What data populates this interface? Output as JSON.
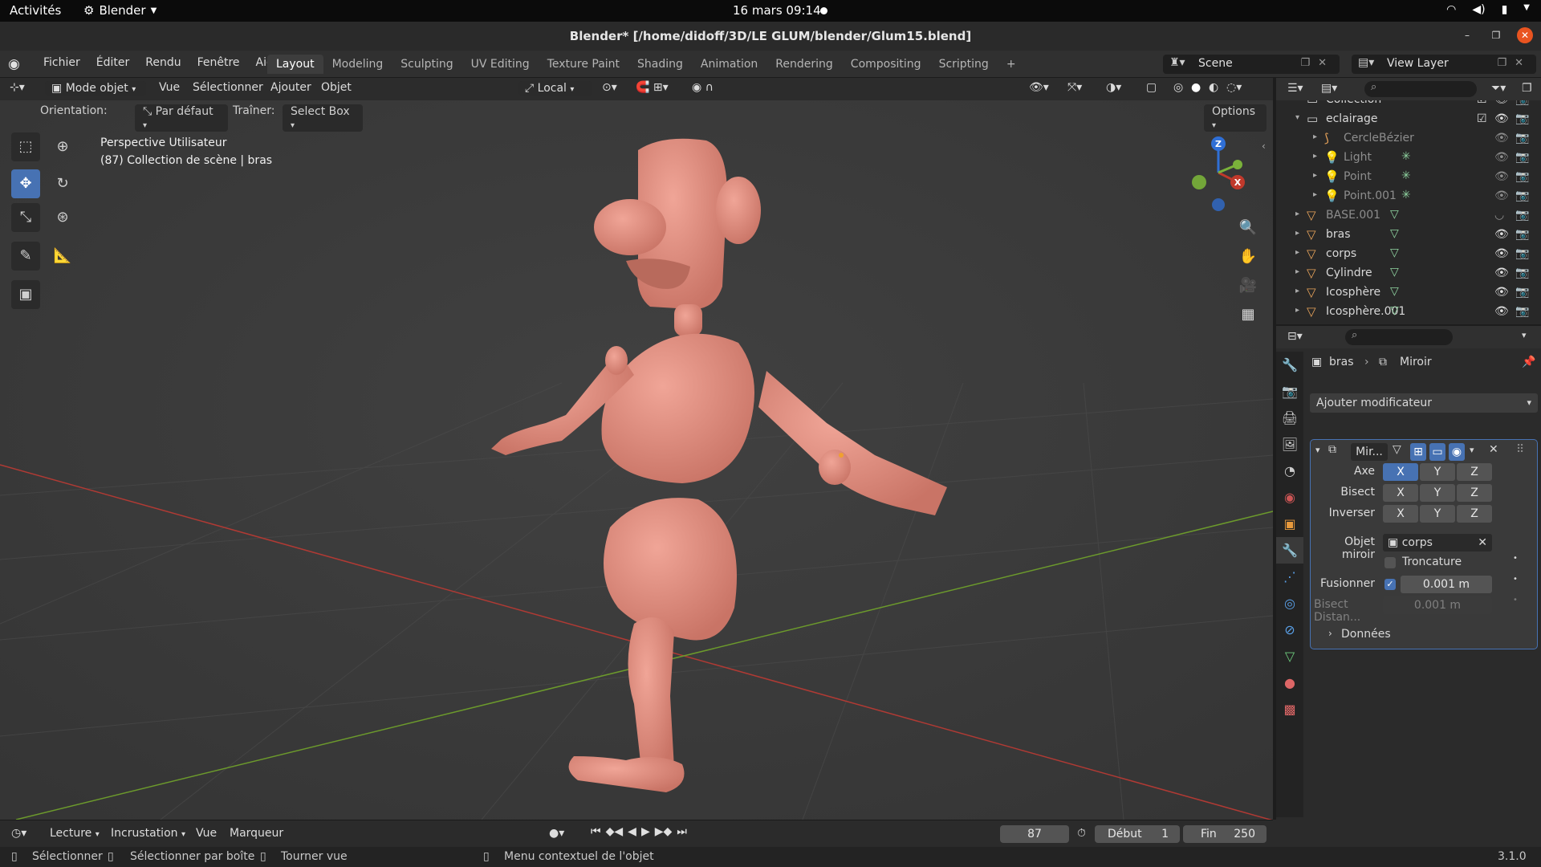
{
  "gnome": {
    "activities": "Activités",
    "app_name": "Blender",
    "clock": "16 mars  09:14"
  },
  "window": {
    "title": "Blender* [/home/didoff/3D/LE GLUM/blender/Glum15.blend]"
  },
  "menu": [
    "Fichier",
    "Éditer",
    "Rendu",
    "Fenêtre",
    "Aide"
  ],
  "workspaces": [
    {
      "label": "Layout",
      "active": true
    },
    {
      "label": "Modeling"
    },
    {
      "label": "Sculpting"
    },
    {
      "label": "UV Editing"
    },
    {
      "label": "Texture Paint"
    },
    {
      "label": "Shading"
    },
    {
      "label": "Animation"
    },
    {
      "label": "Rendering"
    },
    {
      "label": "Compositing"
    },
    {
      "label": "Scripting"
    },
    {
      "label": "+"
    }
  ],
  "scene": {
    "name": "Scene"
  },
  "view_layer": {
    "name": "View Layer"
  },
  "viewport": {
    "mode": "Mode objet",
    "menus": [
      "Vue",
      "Sélectionner",
      "Ajouter",
      "Objet"
    ],
    "transform_orientation": "Local",
    "orientation_label": "Orientation:",
    "orientation_value": "Par défaut",
    "drag_label": "Traîner:",
    "drag_value": "Select Box",
    "options_label": "Options",
    "info_line1": "Perspective Utilisateur",
    "info_line2": "(87) Collection de scène | bras",
    "gizmo": {
      "z": "Z",
      "x": "X"
    }
  },
  "outliner": {
    "rows": [
      {
        "name": "Collection",
        "indent": 0,
        "type": "collection"
      },
      {
        "name": "eclairage",
        "indent": 0,
        "type": "collection",
        "expanded": true
      },
      {
        "name": "CercleBézier",
        "indent": 1,
        "type": "curve",
        "dim": true
      },
      {
        "name": "Light",
        "indent": 1,
        "type": "light",
        "dim": true
      },
      {
        "name": "Point",
        "indent": 1,
        "type": "light",
        "dim": true
      },
      {
        "name": "Point.001",
        "indent": 1,
        "type": "light",
        "dim": true
      },
      {
        "name": "BASE.001",
        "indent": 0,
        "type": "mesh",
        "dim": true
      },
      {
        "name": "bras",
        "indent": 0,
        "type": "mesh"
      },
      {
        "name": "corps",
        "indent": 0,
        "type": "mesh"
      },
      {
        "name": "Cylindre",
        "indent": 0,
        "type": "mesh"
      },
      {
        "name": "Icosphère",
        "indent": 0,
        "type": "mesh"
      },
      {
        "name": "Icosphère.001",
        "indent": 0,
        "type": "mesh"
      }
    ]
  },
  "properties": {
    "breadcrumb_object": "bras",
    "breadcrumb_modifier": "Miroir",
    "add_modifier": "Ajouter modificateur",
    "modifier_name": "Mir...",
    "axis_label": "Axe",
    "bisect_label": "Bisect",
    "flip_label": "Inverser",
    "x": "X",
    "y": "Y",
    "z": "Z",
    "mirror_object_label": "Objet miroir",
    "mirror_object_value": "corps",
    "clipping_label": "Troncature",
    "merge_label": "Fusionner",
    "merge_value": "0.001 m",
    "bisect_distance_label": "Bisect Distan...",
    "bisect_distance_value": "0.001 m",
    "data_label": "Données"
  },
  "timeline": {
    "playback": "Lecture",
    "keying": "Incrustation",
    "view": "Vue",
    "marker": "Marqueur",
    "current_frame": "87",
    "start_label": "Début",
    "start_value": "1",
    "end_label": "Fin",
    "end_value": "250"
  },
  "statusbar": {
    "select": "Sélectionner",
    "box_select": "Sélectionner par boîte",
    "rotate_view": "Tourner vue",
    "context_menu": "Menu contextuel de l'objet",
    "version": "3.1.0"
  },
  "colors": {
    "accent": "#4772b3",
    "skin": "#e39082",
    "x_axis": "#c0392b",
    "y_axis": "#7ab23a",
    "z_axis": "#2f6fd6"
  }
}
